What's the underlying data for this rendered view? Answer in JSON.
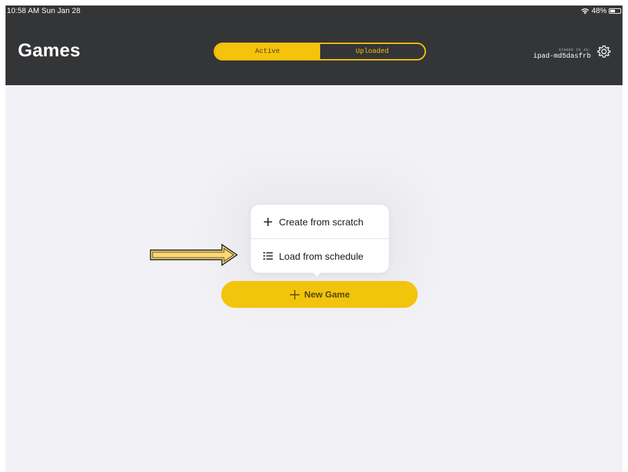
{
  "status_bar": {
    "time": "10:58 AM  Sun Jan 28",
    "battery": "48%",
    "battery_level": 0.48,
    "wifi_icon": "wifi-icon",
    "battery_icon": "battery-icon"
  },
  "header": {
    "title": "Games",
    "segments": [
      {
        "label": "Active",
        "selected": true
      },
      {
        "label": "Uploaded",
        "selected": false
      }
    ],
    "signed_in_label": "SIGNED IN AS:",
    "signed_in_user": "ipad-md5dasfrb",
    "settings_icon": "gear-icon"
  },
  "popover": {
    "items": [
      {
        "label": "Create from scratch",
        "icon": "plus-icon"
      },
      {
        "label": "Load from schedule",
        "icon": "list-icon"
      }
    ]
  },
  "main": {
    "new_game_label": "New Game",
    "new_game_icon": "plus-icon"
  },
  "colors": {
    "header_bg": "#343537",
    "accent": "#f2c40c",
    "page_bg": "#f1f1f6",
    "annotation_arrow": "#fbd873"
  }
}
